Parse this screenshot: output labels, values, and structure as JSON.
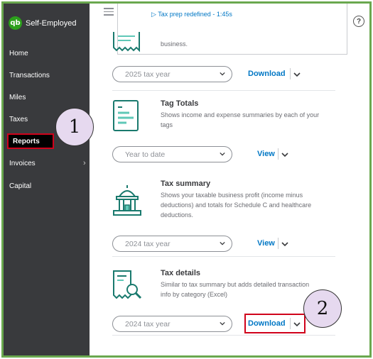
{
  "app": {
    "name": "Self-Employed",
    "logo_text": "qb"
  },
  "sidebar": {
    "items": [
      {
        "label": "Home"
      },
      {
        "label": "Transactions"
      },
      {
        "label": "Miles"
      },
      {
        "label": "Taxes"
      },
      {
        "label": "Reports"
      },
      {
        "label": "Invoices"
      },
      {
        "label": "Capital"
      }
    ]
  },
  "top_panel": {
    "video_link": "Tax prep redefined - 1:45s"
  },
  "help_label": "?",
  "reports": [
    {
      "title": "",
      "description": "business.",
      "selected": "2025 tax year",
      "action": "Download",
      "icon": "receipt-icon"
    },
    {
      "title": "Tag Totals",
      "description": "Shows income and expense summaries by each of your tags",
      "selected": "Year to date",
      "action": "View",
      "icon": "tag-totals-icon"
    },
    {
      "title": "Tax summary",
      "description": "Shows your taxable business profit (income minus deductions) and totals for Schedule C and healthcare deductions.",
      "selected": "2024 tax year",
      "action": "View",
      "icon": "capitol-building-icon"
    },
    {
      "title": "Tax details",
      "description": "Similar to tax summary but adds detailed transaction info by category (Excel)",
      "selected": "2024 tax year",
      "action": "Download",
      "icon": "document-magnifier-icon"
    }
  ],
  "callouts": [
    "1",
    "2"
  ],
  "colors": {
    "sidebar": "#393a3d",
    "link": "#0077c5",
    "brand": "#2ca01c",
    "highlight": "#d0021b",
    "callout": "#e6d9ef",
    "frame": "#6aa84f"
  }
}
